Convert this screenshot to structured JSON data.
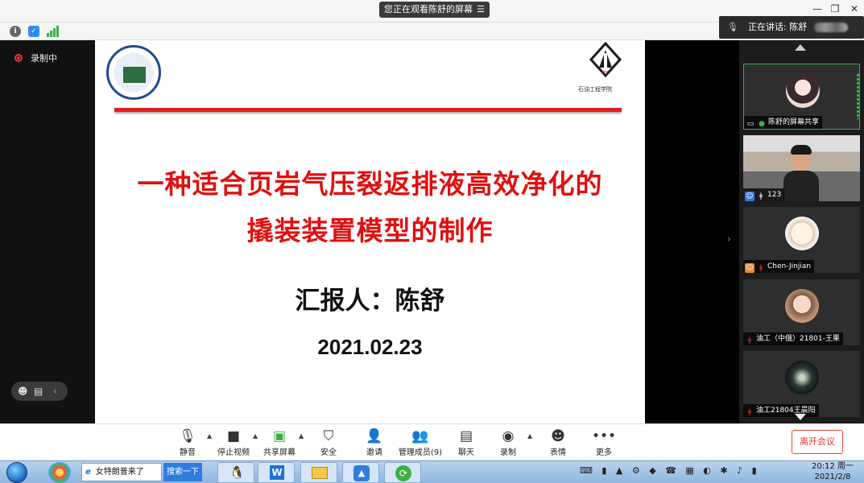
{
  "banner": {
    "viewing_text": "您正在观看陈舒的屏幕"
  },
  "speaker": {
    "label": "正在讲话: 陈舒"
  },
  "left_panel": {
    "recording_label": "录制中"
  },
  "slide": {
    "title_line1": "一种适合页岩气压裂返排液高效净化的",
    "title_line2": "撬装装置模型的制作",
    "reporter": "汇报人：陈舒",
    "date": "2021.02.23",
    "right_logo_text": "石油工程学院"
  },
  "participants": [
    {
      "name": "陈舒的屏幕共享"
    },
    {
      "name": "123"
    },
    {
      "name": "Chen-Jinjian"
    },
    {
      "name": "油工（中俄）21801-王果"
    },
    {
      "name": "油工21804王晨阳"
    }
  ],
  "toolbar": {
    "mute": "静音",
    "stop_video": "停止视频",
    "share_screen": "共享屏幕",
    "security": "安全",
    "invite": "邀请",
    "manage_members": "管理成员(9)",
    "chat": "聊天",
    "record": "录制",
    "reactions": "表情",
    "more": "更多",
    "leave": "离开会议"
  },
  "taskbar": {
    "browser_tab": "女特朗普来了",
    "search_button": "搜索一下",
    "time": "20:12 周一",
    "date": "2021/2/8"
  },
  "colors": {
    "accent_red": "#e01010",
    "active_green": "#3cb043",
    "brand_blue": "#2d7de0"
  }
}
